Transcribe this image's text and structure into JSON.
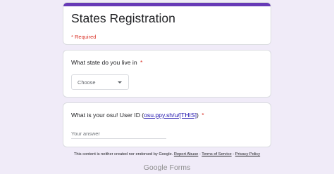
{
  "form": {
    "title": "States Registration",
    "required_note": "* Required",
    "accent_color": "#673ab7"
  },
  "question_state": {
    "title": "What state do you live in",
    "required_mark": "*",
    "dropdown": {
      "selected": "Choose",
      "icon": "dropdown-arrow-icon"
    }
  },
  "question_user_id": {
    "title_prefix": "What is your osu! User ID (",
    "link_text": "osu.ppy.sh/u/[THIS]",
    "title_suffix": ")",
    "required_mark": "*",
    "placeholder": "Your answer"
  },
  "footer": {
    "disclaimer": "This content is neither created nor endorsed by Google.",
    "links": [
      "Report Abuse",
      "Terms of Service",
      "Privacy Policy"
    ],
    "separator": " - ",
    "logo_google": "Google",
    "logo_forms": "Forms"
  }
}
